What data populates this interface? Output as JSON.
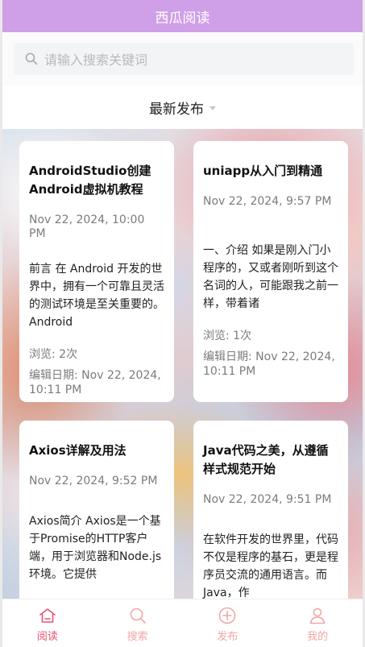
{
  "header": {
    "title": "西瓜阅读"
  },
  "search": {
    "placeholder": "请输入搜索关键词"
  },
  "filter": {
    "selected": "最新发布"
  },
  "colors": {
    "header_bg": "#cf9fe7",
    "tab_active": "#e8556f",
    "tab_inactive": "#f2a6a6"
  },
  "articles": [
    {
      "title": "AndroidStudio创建Android虚拟机教程",
      "date": "Nov 22, 2024, 10:00 PM",
      "excerpt": "前言 在 Android 开发的世界中，拥有一个可靠且灵活的测试环境是至关重要的。Android",
      "views": "浏览: 2次",
      "edited": "编辑日期: Nov 22, 2024, 10:11 PM"
    },
    {
      "title": "uniapp从入门到精通",
      "date": "Nov 22, 2024, 9:57 PM",
      "excerpt": "一、介绍 如果是刚入门小程序的，又或者刚听到这个名词的人，可能跟我之前一样，带着诸",
      "views": "浏览: 1次",
      "edited": "编辑日期: Nov 22, 2024, 10:11 PM"
    },
    {
      "title": "Axios详解及用法",
      "date": "Nov 22, 2024, 9:52 PM",
      "excerpt": "Axios简介 Axios是一个基于Promise的HTTP客户端，用于浏览器和Node.js环境。它提供"
    },
    {
      "title": "Java代码之美，从遵循样式规范开始",
      "date": "Nov 22, 2024, 9:51 PM",
      "excerpt": "在软件开发的世界里，代码不仅是程序的基石，更是程序员交流的通用语言。而Java，作"
    }
  ],
  "tabbar": [
    {
      "label": "阅读",
      "icon": "home-icon",
      "active": true
    },
    {
      "label": "搜索",
      "icon": "search-icon",
      "active": false
    },
    {
      "label": "发布",
      "icon": "plus-circle-icon",
      "active": false
    },
    {
      "label": "我的",
      "icon": "user-icon",
      "active": false
    }
  ]
}
